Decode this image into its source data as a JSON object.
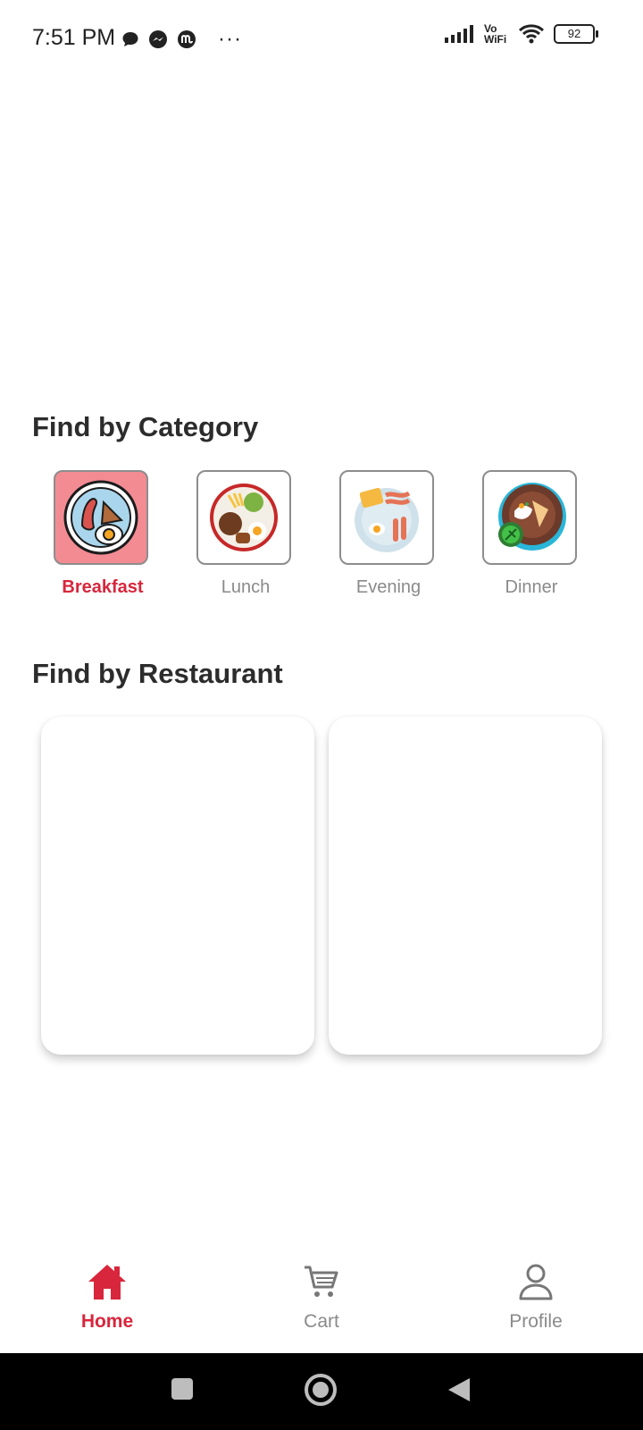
{
  "status_bar": {
    "time": "7:51 PM",
    "notifications": [
      "chat-bubble-icon",
      "messenger-icon",
      "app-icon"
    ],
    "more": "···",
    "network": "Vo WiFi",
    "battery": "92"
  },
  "sections": {
    "category_title": "Find by Category",
    "restaurant_title": "Find by Restaurant"
  },
  "categories": [
    {
      "label": "Breakfast",
      "icon": "breakfast-plate-icon",
      "selected": true
    },
    {
      "label": "Lunch",
      "icon": "lunch-plate-icon",
      "selected": false
    },
    {
      "label": "Evening",
      "icon": "evening-plate-icon",
      "selected": false
    },
    {
      "label": "Dinner",
      "icon": "dinner-plate-icon",
      "selected": false
    }
  ],
  "bottom_nav": [
    {
      "label": "Home",
      "icon": "home-icon",
      "active": true
    },
    {
      "label": "Cart",
      "icon": "cart-icon",
      "active": false
    },
    {
      "label": "Profile",
      "icon": "profile-icon",
      "active": false
    }
  ],
  "colors": {
    "accent": "#d8263c",
    "selected_bg": "#f38b93",
    "inactive_text": "#8a8a8a"
  }
}
